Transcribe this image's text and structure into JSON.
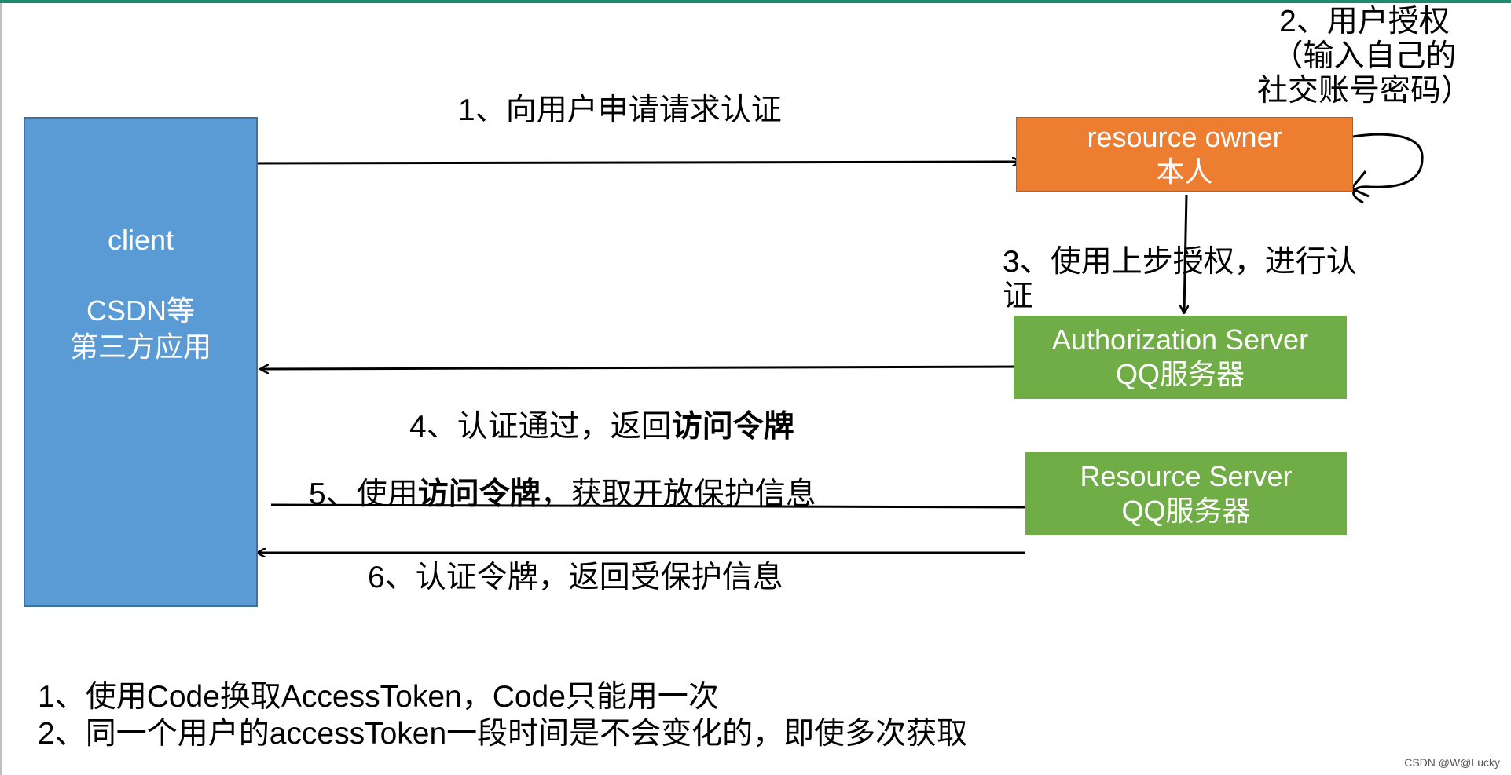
{
  "client": {
    "line1": "client",
    "line2": "CSDN等",
    "line3": "第三方应用"
  },
  "resource_owner": {
    "line1": "resource owner",
    "line2": "本人"
  },
  "authorization_server": {
    "line1": "Authorization Server",
    "line2": "QQ服务器"
  },
  "resource_server": {
    "line1": "Resource Server",
    "line2": "QQ服务器"
  },
  "steps": {
    "step1": "1、向用户申请请求认证",
    "step2": {
      "line1": "2、用户授权",
      "line2": "（输入自己的",
      "line3": "社交账号密码）"
    },
    "step3": {
      "line1": "3、使用上步授权，进行认",
      "line2": "证"
    },
    "step4": {
      "prefix": "4、认证通过，返回",
      "bold": "访问令牌"
    },
    "step5": {
      "prefix": "5、使用",
      "bold": "访问令牌",
      "suffix": "，获取开放保护信息"
    },
    "step6": "6、认证令牌，返回受保护信息"
  },
  "notes": [
    "1、使用Code换取AccessToken，Code只能用一次",
    "2、同一个用户的accessToken一段时间是不会变化的，即使多次获取"
  ],
  "watermark": "CSDN @W@Lucky",
  "colors": {
    "client": "#5b9bd5",
    "resource_owner": "#ed7d31",
    "servers": "#70ad47",
    "top_bar": "#1f8a70"
  }
}
